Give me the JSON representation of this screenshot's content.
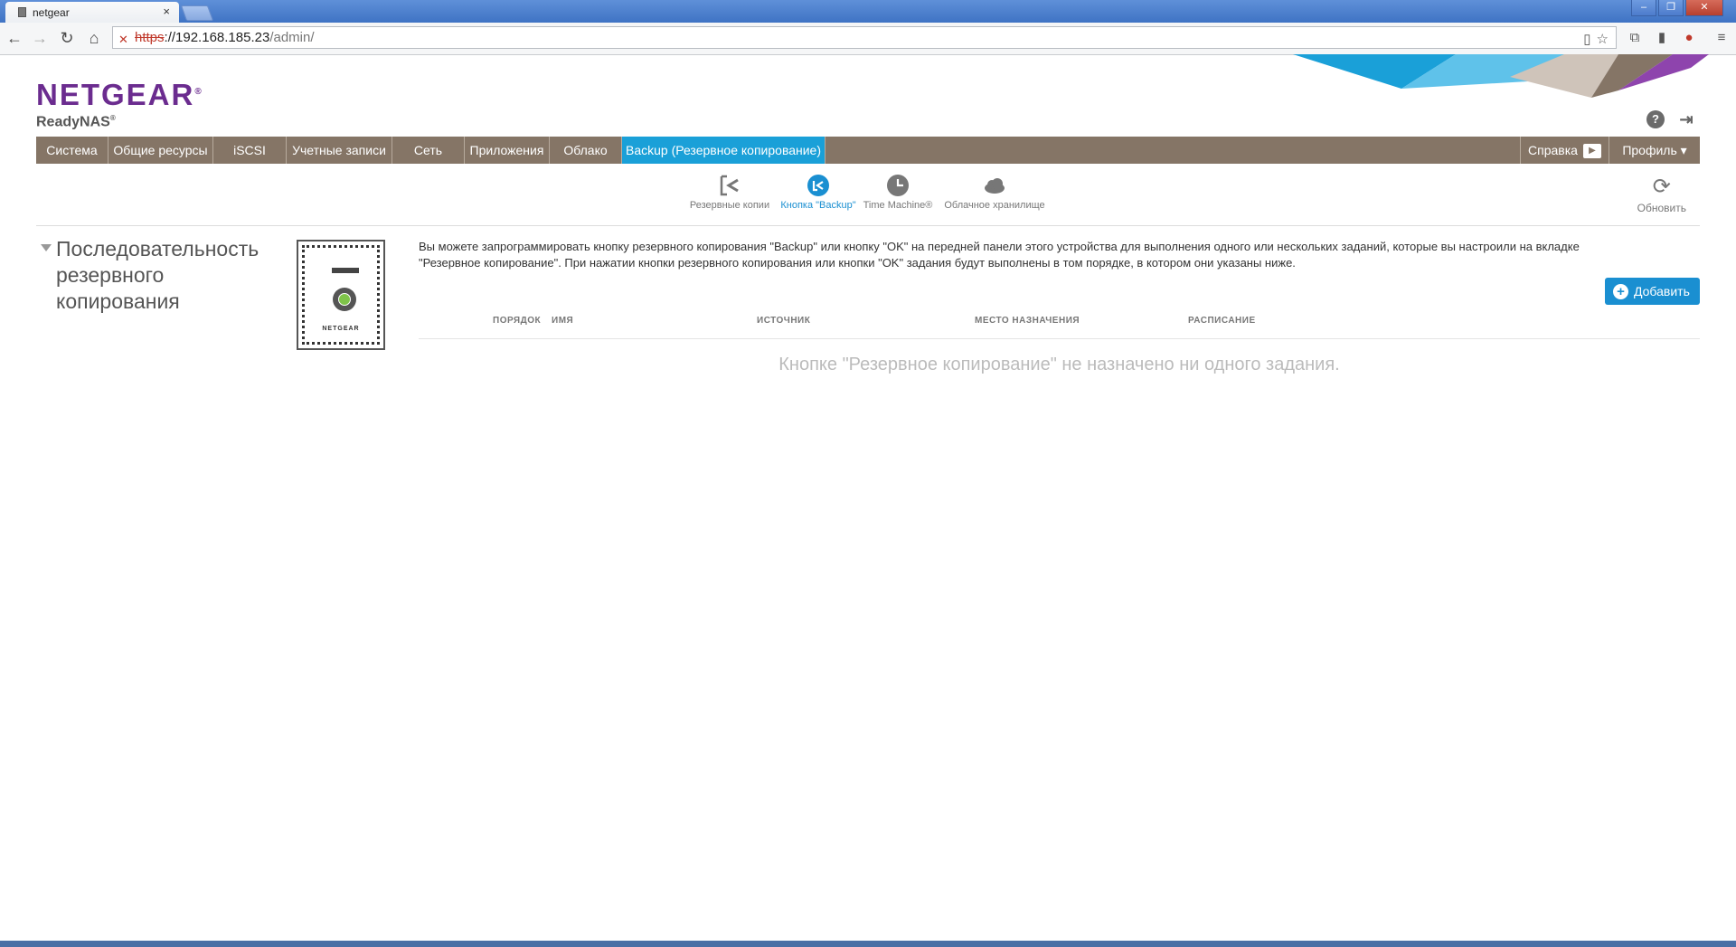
{
  "browser": {
    "tab_title": "netgear",
    "tab_close": "×",
    "url_scheme": "https",
    "url_host": "://192.168.185.23",
    "url_path": "/admin/",
    "win_min": "–",
    "win_max": "❐",
    "win_close": "✕"
  },
  "header": {
    "brand": "NETGEAR",
    "product": "ReadyNAS",
    "help_icon": "?",
    "logout_icon": "⇥"
  },
  "mainnav": {
    "items": [
      {
        "label": "Система"
      },
      {
        "label": "Общие ресурсы"
      },
      {
        "label": "iSCSI"
      },
      {
        "label": "Учетные записи"
      },
      {
        "label": "Сеть"
      },
      {
        "label": "Приложения"
      },
      {
        "label": "Облако"
      },
      {
        "label": "Backup (Резервное копирование)"
      }
    ],
    "help_label": "Справка",
    "profile_label": "Профиль ▾"
  },
  "subnav": {
    "items": [
      {
        "label": "Резервные копии",
        "icon": "backup-jobs-icon"
      },
      {
        "label": "Кнопка \"Backup\"",
        "icon": "backup-button-icon"
      },
      {
        "label": "Time Machine®",
        "icon": "time-machine-icon"
      },
      {
        "label": "Облачное хранилище",
        "icon": "cloud-icon"
      }
    ],
    "refresh_label": "Обновить"
  },
  "section": {
    "title": "Последовательность резервного копирования",
    "device_brand": "NETGEAR",
    "description": "Вы можете запрограммировать кнопку резервного копирования \"Backup\" или кнопку \"OK\" на передней панели этого устройства для выполнения одного или нескольких заданий, которые вы настроили на вкладке \"Резервное копирование\". При нажатии кнопки резервного копирования или кнопки \"OK\" задания будут выполнены в том порядке, в котором они указаны ниже.",
    "add_label": "Добавить",
    "add_icon": "+"
  },
  "table": {
    "headers": [
      "ПОРЯДОК",
      "ИМЯ",
      "ИСТОЧНИК",
      "МЕСТО НАЗНАЧЕНИЯ",
      "РАСПИСАНИЕ"
    ],
    "empty_text": "Кнопке \"Резервное копирование\" не назначено ни одного задания."
  },
  "colors": {
    "brand": "#6b2c8f",
    "nav_bg": "#857566",
    "accent": "#1aa0d8"
  }
}
